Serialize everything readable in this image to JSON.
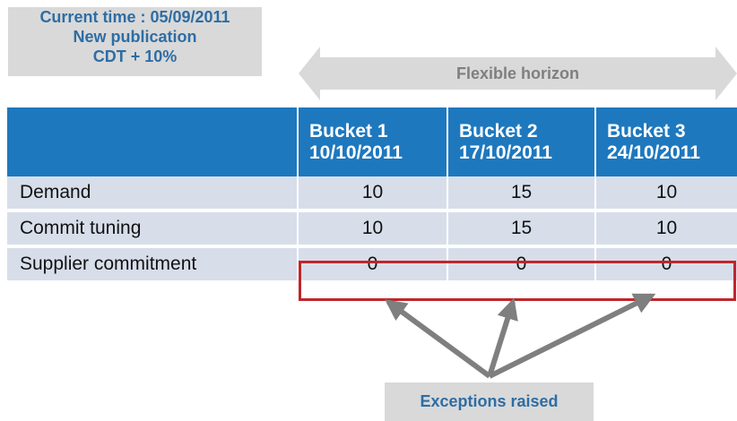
{
  "info": {
    "line1": "Current time : 05/09/2011",
    "line2": "New publication",
    "line3": "CDT + 10%"
  },
  "horizon": {
    "label": "Flexible horizon"
  },
  "table": {
    "columns": [
      {
        "title": "Bucket 1",
        "date": "10/10/2011"
      },
      {
        "title": "Bucket 2",
        "date": "17/10/2011"
      },
      {
        "title": "Bucket 3",
        "date": "24/10/2011"
      }
    ],
    "rows": [
      {
        "label": "Demand",
        "values": [
          "10",
          "15",
          "10"
        ]
      },
      {
        "label": "Commit tuning",
        "values": [
          "10",
          "15",
          "10"
        ]
      },
      {
        "label": "Supplier commitment",
        "values": [
          "0",
          "0",
          "0"
        ]
      }
    ]
  },
  "exceptions": {
    "label": "Exceptions raised"
  },
  "colors": {
    "header_blue": "#1e78be",
    "row_fill": "#d7deea",
    "highlight_red": "#c0252b",
    "callout_text": "#2e6da4",
    "callout_fill": "#d9d9d9"
  }
}
